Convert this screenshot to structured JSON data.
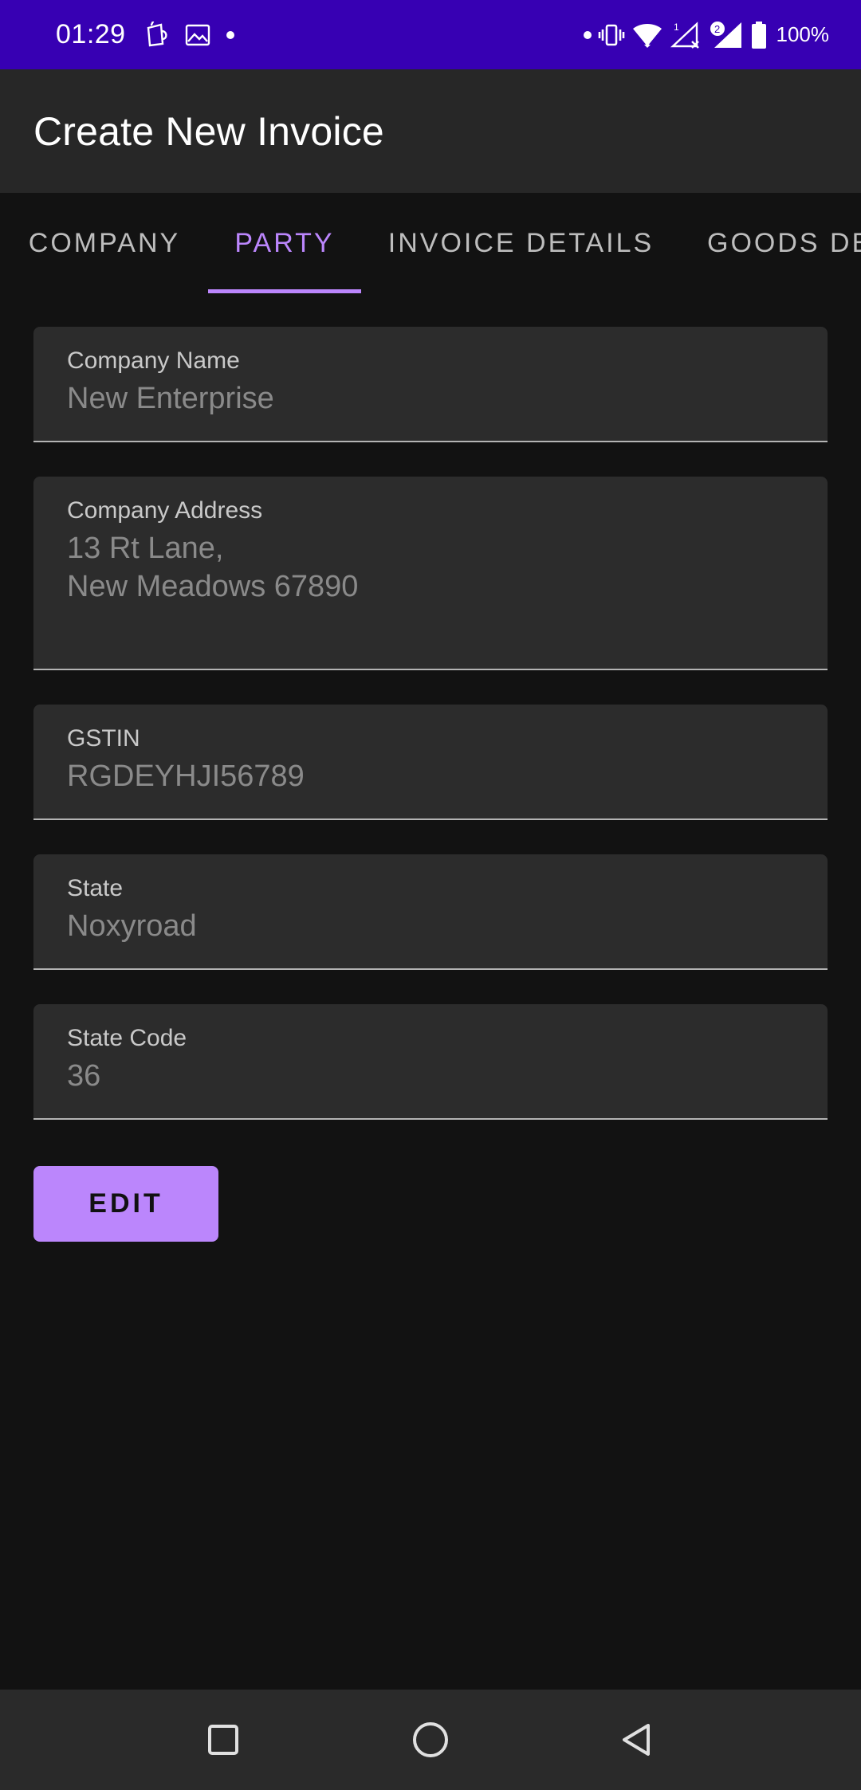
{
  "status_bar": {
    "time": "01:29",
    "battery_percent": "100%",
    "icons_left": [
      "coffee-cup-icon",
      "image-icon",
      "dot-icon"
    ],
    "icons_right": [
      "dot-icon",
      "vibrate-icon",
      "wifi-icon",
      "signal-sim1-icon",
      "signal-sim2-icon",
      "battery-icon"
    ],
    "sim1_label": "1",
    "sim2_label": "2"
  },
  "app_bar": {
    "title": "Create New Invoice"
  },
  "tabs": [
    {
      "label": "COMPANY",
      "active": false
    },
    {
      "label": "PARTY",
      "active": true
    },
    {
      "label": "INVOICE DETAILS",
      "active": false
    },
    {
      "label": "GOODS DE",
      "active": false
    }
  ],
  "form": {
    "company_name": {
      "label": "Company Name",
      "value": "New Enterprise"
    },
    "company_address": {
      "label": "Company Address",
      "value": "13 Rt Lane,\nNew Meadows 67890"
    },
    "gstin": {
      "label": "GSTIN",
      "value": "RGDEYHJI56789"
    },
    "state": {
      "label": "State",
      "value": "Noxyroad"
    },
    "state_code": {
      "label": "State Code",
      "value": "36"
    }
  },
  "actions": {
    "edit_label": "EDIT"
  },
  "nav_bar": {
    "buttons": [
      "recents-square-icon",
      "home-circle-icon",
      "back-triangle-icon"
    ]
  },
  "colors": {
    "status_bar": "#3700b3",
    "app_bar": "#272727",
    "background": "#121212",
    "accent": "#bb86fc",
    "field_background": "#2c2c2c"
  }
}
